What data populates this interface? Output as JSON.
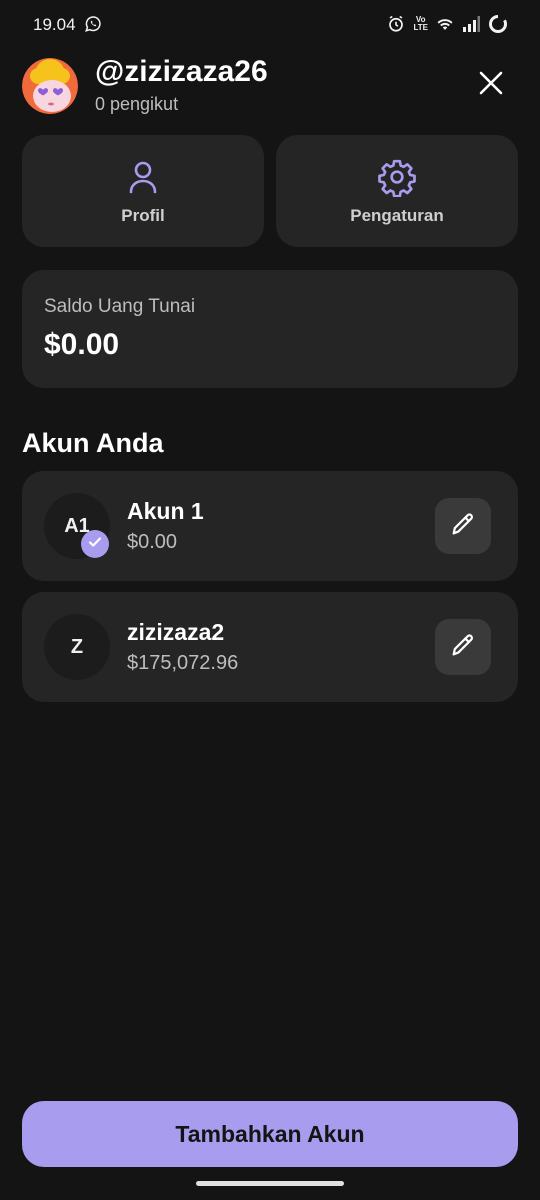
{
  "status_bar": {
    "time": "19.04",
    "icons": [
      "whatsapp-icon",
      "alarm-icon",
      "volte-icon",
      "wifi-icon",
      "signal-icon",
      "battery-ring-icon"
    ],
    "network_label": "Vo LTE"
  },
  "header": {
    "username": "@zizizaza26",
    "followers": "0 pengikut",
    "close_icon": "close-icon"
  },
  "quick_actions": [
    {
      "label": "Profil",
      "icon": "user-icon"
    },
    {
      "label": "Pengaturan",
      "icon": "gear-icon"
    }
  ],
  "balance": {
    "title": "Saldo Uang Tunai",
    "value": "$0.00"
  },
  "accounts_section": {
    "title": "Akun Anda",
    "accounts": [
      {
        "initials": "A1",
        "name": "Akun 1",
        "balance": "$0.00",
        "active": true
      },
      {
        "initials": "Z",
        "name": "zizizaza2",
        "balance": "$175,072.96",
        "active": false
      }
    ]
  },
  "footer": {
    "add_button_label": "Tambahkan Akun"
  },
  "colors": {
    "background": "#141414",
    "card": "#252525",
    "accent": "#a89cee",
    "text_primary": "#ffffff",
    "text_secondary": "#bdbdbd"
  }
}
